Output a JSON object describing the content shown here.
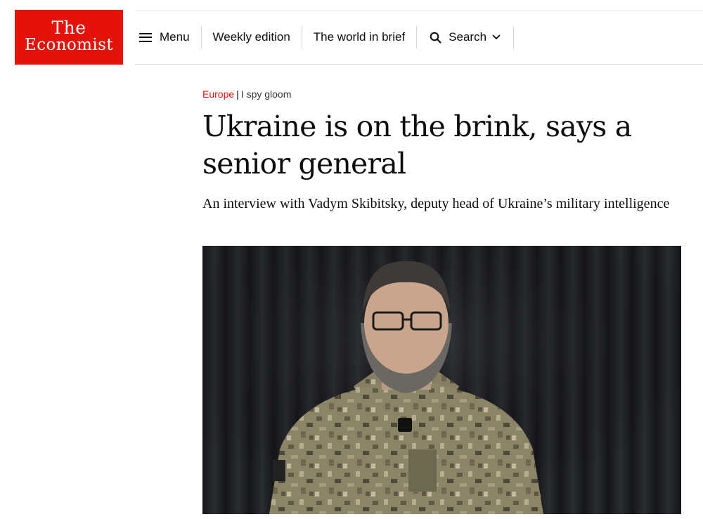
{
  "logo": {
    "line1": "The",
    "line2": "Economist"
  },
  "nav": {
    "menu_label": "Menu",
    "weekly_label": "Weekly edition",
    "brief_label": "The world in brief",
    "search_label": "Search"
  },
  "article": {
    "section": "Europe",
    "separator": "|",
    "fly_title": "I spy gloom",
    "headline": "Ukraine is on the brink, says a senior general",
    "rubric": "An interview with Vadym Skibitsky, deputy head of Ukraine’s military intelligence"
  },
  "colors": {
    "brand_red": "#e3120b",
    "text": "#0d0d0d",
    "divider": "#d6d6d6"
  },
  "icons": [
    "menu-icon",
    "search-icon",
    "chevron-down-icon"
  ]
}
